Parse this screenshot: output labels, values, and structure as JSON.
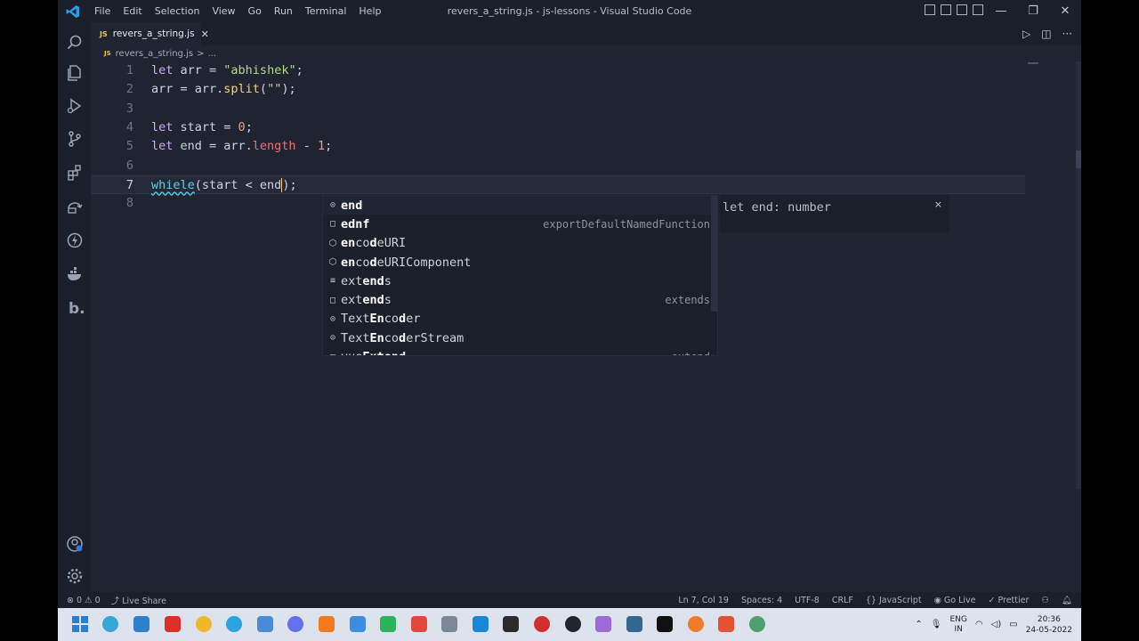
{
  "window": {
    "title": "revers_a_string.js - js-lessons - Visual Studio Code",
    "menu": [
      "File",
      "Edit",
      "Selection",
      "View",
      "Go",
      "Run",
      "Terminal",
      "Help"
    ],
    "controls": [
      "—",
      "❐",
      "✕"
    ]
  },
  "tab": {
    "badge": "JS",
    "name": "revers_a_string.js",
    "close": "✕"
  },
  "breadcrumb": {
    "file": "revers_a_string.js",
    "sep": ">",
    "more": "..."
  },
  "editor_actions": [
    "▷",
    "◫",
    "···"
  ],
  "code": {
    "lines": [
      {
        "n": "1",
        "tokens": [
          {
            "t": "let",
            "c": "kw"
          },
          {
            "t": " arr = "
          },
          {
            "t": "\"abhishek\"",
            "c": "str"
          },
          {
            "t": ";"
          }
        ]
      },
      {
        "n": "2",
        "tokens": [
          {
            "t": "arr = arr."
          },
          {
            "t": "split",
            "c": "fn"
          },
          {
            "t": "("
          },
          {
            "t": "\"\"",
            "c": "str"
          },
          {
            "t": ");"
          }
        ]
      },
      {
        "n": "3",
        "tokens": []
      },
      {
        "n": "4",
        "tokens": [
          {
            "t": "let",
            "c": "kw"
          },
          {
            "t": " start = "
          },
          {
            "t": "0",
            "c": "num"
          },
          {
            "t": ";"
          }
        ]
      },
      {
        "n": "5",
        "tokens": [
          {
            "t": "let",
            "c": "kw"
          },
          {
            "t": " end = arr."
          },
          {
            "t": "length",
            "c": "prop"
          },
          {
            "t": " - "
          },
          {
            "t": "1",
            "c": "num"
          },
          {
            "t": ";"
          }
        ]
      },
      {
        "n": "6",
        "tokens": []
      },
      {
        "n": "7",
        "tokens": [
          {
            "t": "whiele",
            "c": "err"
          },
          {
            "t": "(start < end"
          },
          {
            "t": "|",
            "c": "cursor"
          },
          {
            "t": ");"
          }
        ],
        "current": true
      },
      {
        "n": "8",
        "tokens": []
      }
    ]
  },
  "suggest": {
    "items": [
      {
        "icon": "⊙",
        "pre": "",
        "bold": "end",
        "post": "",
        "detail": "",
        "selected": true
      },
      {
        "icon": "□",
        "pre": "",
        "bold": "ednf",
        "post": "",
        "detail": "exportDefaultNamedFunction"
      },
      {
        "icon": "⬡",
        "pre": "",
        "bold": "en",
        "mid": "co",
        "bold2": "d",
        "post": "eURI",
        "detail": ""
      },
      {
        "icon": "⬡",
        "pre": "",
        "bold": "en",
        "mid": "co",
        "bold2": "d",
        "post": "eURIComponent",
        "detail": ""
      },
      {
        "icon": "≡",
        "pre": "ext",
        "bold": "end",
        "post": "s",
        "detail": ""
      },
      {
        "icon": "□",
        "pre": "ext",
        "bold": "end",
        "post": "s",
        "detail": "extends"
      },
      {
        "icon": "⊙",
        "pre": "Text",
        "bold": "En",
        "mid": "co",
        "bold2": "d",
        "post": "er",
        "detail": ""
      },
      {
        "icon": "⊙",
        "pre": "Text",
        "bold": "En",
        "mid": "co",
        "bold2": "d",
        "post": "erStream",
        "detail": ""
      },
      {
        "icon": "□",
        "pre": "vue",
        "bold": "Ext",
        "mid": "",
        "bold2": "end",
        "post": "",
        "detail": "extend"
      }
    ],
    "details": {
      "text": "let end: number",
      "close": "×"
    }
  },
  "status": {
    "errors": "⊗ 0",
    "warnings": "⚠ 0",
    "live_share": "Live Share",
    "position": "Ln 7, Col 19",
    "spaces": "Spaces: 4",
    "encoding": "UTF-8",
    "eol": "CRLF",
    "language": "JavaScript",
    "go_live": "Go Live",
    "prettier": "✓ Prettier"
  },
  "taskbar": {
    "lang_top": "ENG",
    "lang_bottom": "IN",
    "time": "20:36",
    "date": "24-05-2022"
  },
  "colors": {
    "accent": "#5ccfe6",
    "keyword": "#d4a6ff",
    "string": "#b5d98a",
    "number": "#f29e74",
    "property": "#f07178",
    "function": "#ffd173"
  }
}
